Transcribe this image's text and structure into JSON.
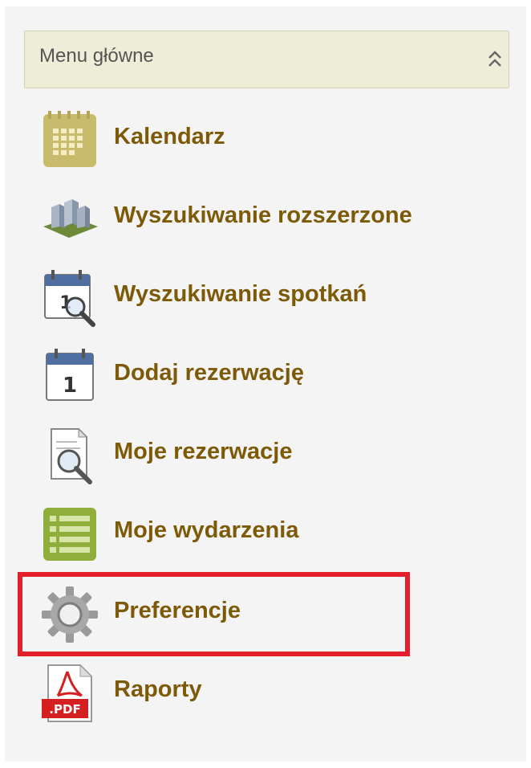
{
  "menu": {
    "title": "Menu główne",
    "collapse_icon": "double-chevron-up-icon"
  },
  "items": [
    {
      "label": "Kalendarz",
      "icon": "calendar-grid-icon"
    },
    {
      "label": "Wyszukiwanie rozszerzone",
      "icon": "buildings-icon"
    },
    {
      "label": "Wyszukiwanie spotkań",
      "icon": "calendar-search-icon"
    },
    {
      "label": "Dodaj rezerwację",
      "icon": "calendar-day-icon"
    },
    {
      "label": "Moje rezerwacje",
      "icon": "document-search-icon"
    },
    {
      "label": "Moje wydarzenia",
      "icon": "list-icon"
    },
    {
      "label": "Preferencje",
      "icon": "gear-icon"
    },
    {
      "label": "Raporty",
      "icon": "pdf-icon"
    }
  ],
  "highlighted_item": "Preferencje",
  "colors": {
    "link": "#7d5a08",
    "header_bg": "#eeeed8",
    "highlight": "#e21f2a"
  }
}
